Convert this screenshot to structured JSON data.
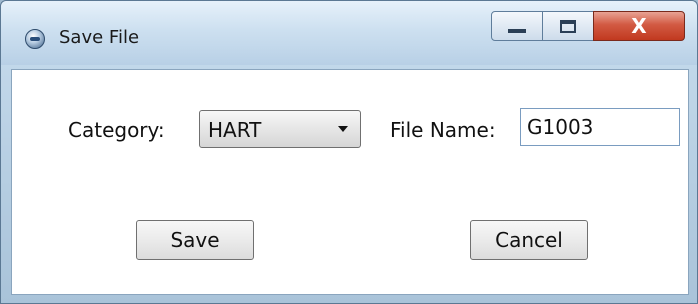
{
  "window": {
    "title": "Save File",
    "controls": {
      "close_glyph": "X"
    }
  },
  "form": {
    "category_label": "Category:",
    "category_value": "HART",
    "filename_label": "File Name:",
    "filename_value": "G1003"
  },
  "buttons": {
    "save": "Save",
    "cancel": "Cancel"
  },
  "colors": {
    "close_button": "#c1391f",
    "title_bar": "#cde0f0",
    "client_bg": "#ffffff"
  },
  "icons": [
    "app-icon",
    "minimize-icon",
    "maximize-icon",
    "close-icon",
    "dropdown-arrow-icon"
  ]
}
